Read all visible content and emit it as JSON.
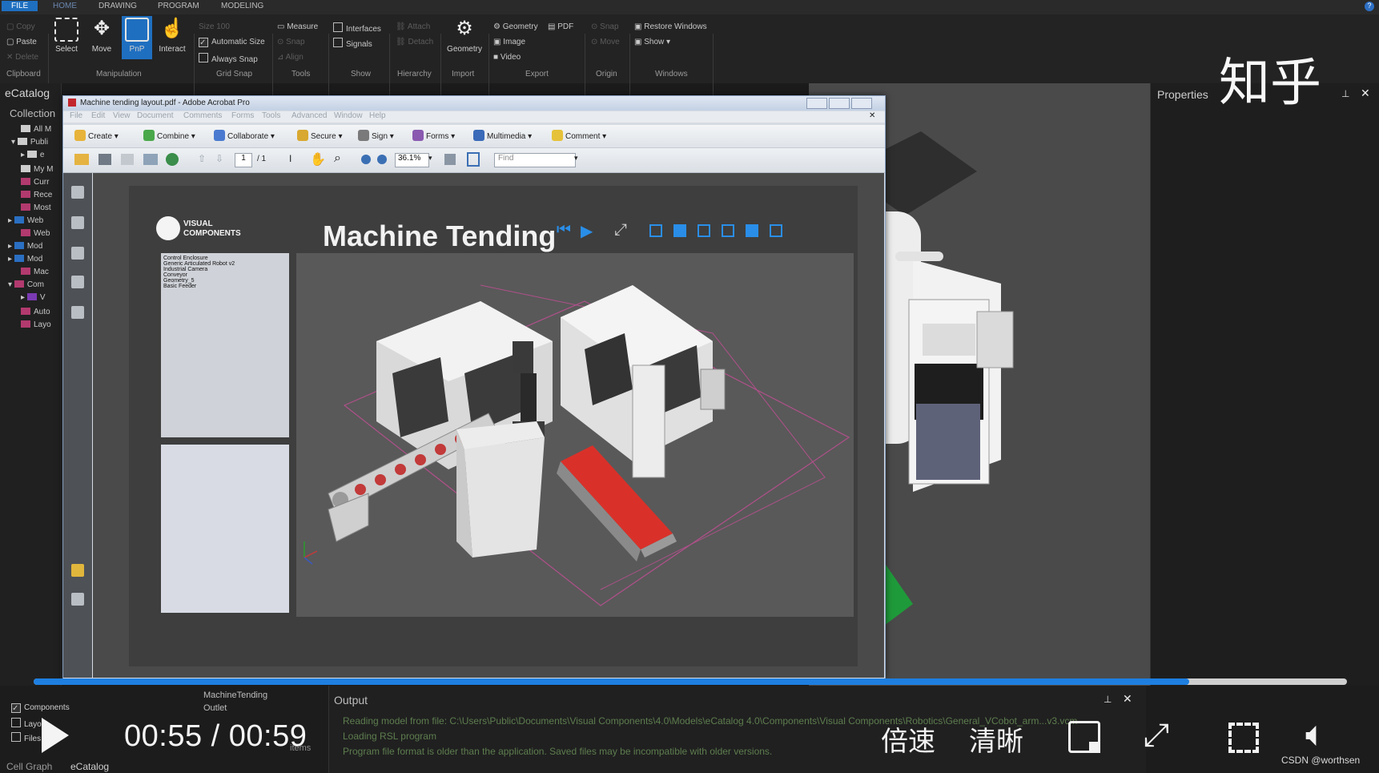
{
  "ribbon": {
    "tabs": [
      "FILE",
      "HOME",
      "DRAWING",
      "PROGRAM",
      "MODELING"
    ],
    "clipboard": {
      "copy": "Copy",
      "paste": "Paste",
      "delete": "Delete",
      "label": "Clipboard"
    },
    "manipulation": {
      "select": "Select",
      "move": "Move",
      "pnp": "PnP",
      "interact": "Interact",
      "label": "Manipulation"
    },
    "grid_snap": {
      "size": "Size 100",
      "automatic": "Automatic Size",
      "always": "Always Snap",
      "label": "Grid Snap"
    },
    "tools": {
      "measure": "Measure",
      "snap": "Snap",
      "align": "Align",
      "label": "Tools"
    },
    "show": {
      "interfaces": "Interfaces",
      "signals": "Signals",
      "label": "Show"
    },
    "hierarchy": {
      "attach": "Attach",
      "detach": "Detach",
      "label": "Hierarchy"
    },
    "import": {
      "geometry": "Geometry",
      "label": "Import"
    },
    "export": {
      "geometry": "Geometry",
      "pdf": "PDF",
      "image": "Image",
      "video": "Video",
      "label": "Export"
    },
    "origin": {
      "snap": "Snap",
      "move": "Move",
      "label": "Origin"
    },
    "windows": {
      "restore": "Restore Windows",
      "show": "Show",
      "label": "Windows"
    }
  },
  "left_panel": {
    "title": "eCatalog",
    "collections": "Collection",
    "items": [
      "All M",
      "Publi",
      "e",
      "My M",
      "Curr",
      "Rece",
      "Most",
      "Web",
      "Web",
      "Mod",
      "Mod",
      "Mac",
      "Com",
      "V",
      "Auto",
      "Layo"
    ]
  },
  "properties": {
    "title": "Properties"
  },
  "acrobat": {
    "title": "Machine tending layout.pdf - Adobe Acrobat Pro",
    "menu": [
      "File",
      "Edit",
      "View",
      "Document",
      "Comments",
      "Forms",
      "Tools",
      "Advanced",
      "Window",
      "Help"
    ],
    "toolbar": [
      "Create",
      "Combine",
      "Collaborate",
      "Secure",
      "Sign",
      "Forms",
      "Multimedia",
      "Comment"
    ],
    "page_current": "1",
    "page_total": "/ 1",
    "zoom": "36.1%",
    "find_placeholder": "Find"
  },
  "document": {
    "logo_line1": "VISUAL",
    "logo_line2": "COMPONENTS",
    "title": "Machine Tending",
    "components": [
      "Control Enclosure",
      "Generic Articulated Robot v2",
      "Industrial Camera",
      "Conveyor",
      "Geometry_5",
      "Basic Feeder"
    ]
  },
  "bottom_panel": {
    "checks": [
      "Components",
      "Layout",
      "Files"
    ],
    "tree": [
      "MachineTending",
      "Outlet"
    ],
    "items_label": "items",
    "tabs": [
      "Cell Graph",
      "eCatalog"
    ],
    "output_title": "Output",
    "output_lines": [
      "Reading model from file: C:\\Users\\Public\\Documents\\Visual Components\\4.0\\Models\\eCatalog 4.0\\Components\\Visual Components\\Robotics\\General_VCobot_arm...v3.vcm",
      "Loading RSL program",
      "Program file format is older than the application. Saved files may be incompatible with older versions."
    ]
  },
  "video": {
    "time": "00:55 / 00:59",
    "progress": 0.88,
    "speed": "倍速",
    "quality": "清晰",
    "watermark": "知乎",
    "credit": "CSDN @worthsen"
  },
  "colors": {
    "accent": "#1f6fc0",
    "progress": "#1e7fe0",
    "conveyor_red": "#d9312a",
    "conveyor_green": "#1f9a3a"
  }
}
